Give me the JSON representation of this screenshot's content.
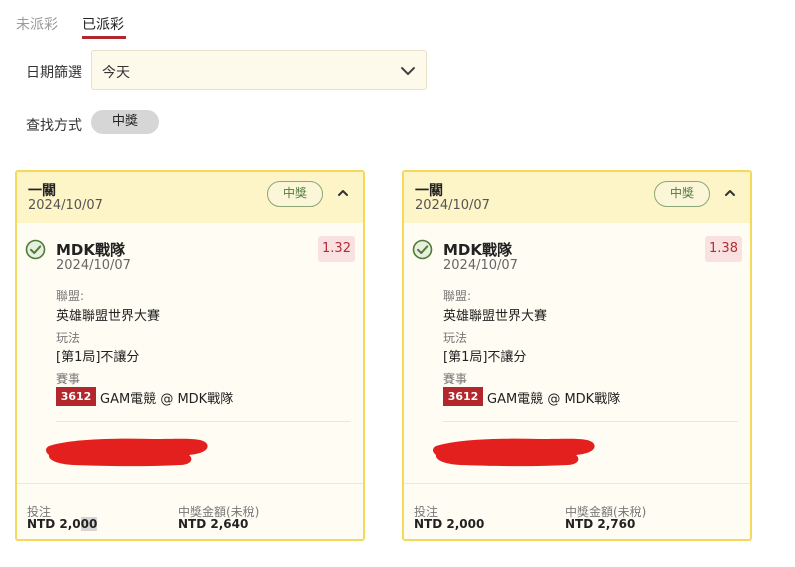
{
  "tabs": [
    {
      "label": "未派彩",
      "active": false
    },
    {
      "label": "已派彩",
      "active": true
    }
  ],
  "filters": {
    "date_label": "日期篩選",
    "date_value": "今天",
    "method_label": "查找方式",
    "method_value": "中獎"
  },
  "cards": [
    {
      "title": "一關",
      "date": "2024/10/07",
      "badge": "中獎",
      "team": "MDK戰隊",
      "team_date": "2024/10/07",
      "odds": "1.32",
      "league_label": "聯盟:",
      "league": "英雄聯盟世界大賽",
      "play_label": "玩法",
      "play": "[第1局]不讓分",
      "event_label": "賽事",
      "event_id": "3612",
      "event_name": "GAM電競 @ MDK戰隊",
      "stake_label": "投注",
      "stake_prefix": "NTD 2,0",
      "stake_suffix": "00",
      "payout_label": "中獎金額(未稅)",
      "payout": "NTD 2,640"
    },
    {
      "title": "一關",
      "date": "2024/10/07",
      "badge": "中獎",
      "team": "MDK戰隊",
      "team_date": "2024/10/07",
      "odds": "1.38",
      "league_label": "聯盟:",
      "league": "英雄聯盟世界大賽",
      "play_label": "玩法",
      "play": "[第1局]不讓分",
      "event_label": "賽事",
      "event_id": "3612",
      "event_name": "GAM電競 @ MDK戰隊",
      "stake_label": "投注",
      "stake": "NTD 2,000",
      "payout_label": "中獎金額(未稅)",
      "payout": "NTD 2,760"
    }
  ],
  "colors": {
    "accent_red": "#b3262b",
    "card_border": "#f4d95b",
    "card_header": "#fdf4c7",
    "win_green": "#4f7a3c"
  },
  "icons": [
    "chevron-down-icon",
    "chevron-up-icon",
    "check-circle-icon"
  ]
}
